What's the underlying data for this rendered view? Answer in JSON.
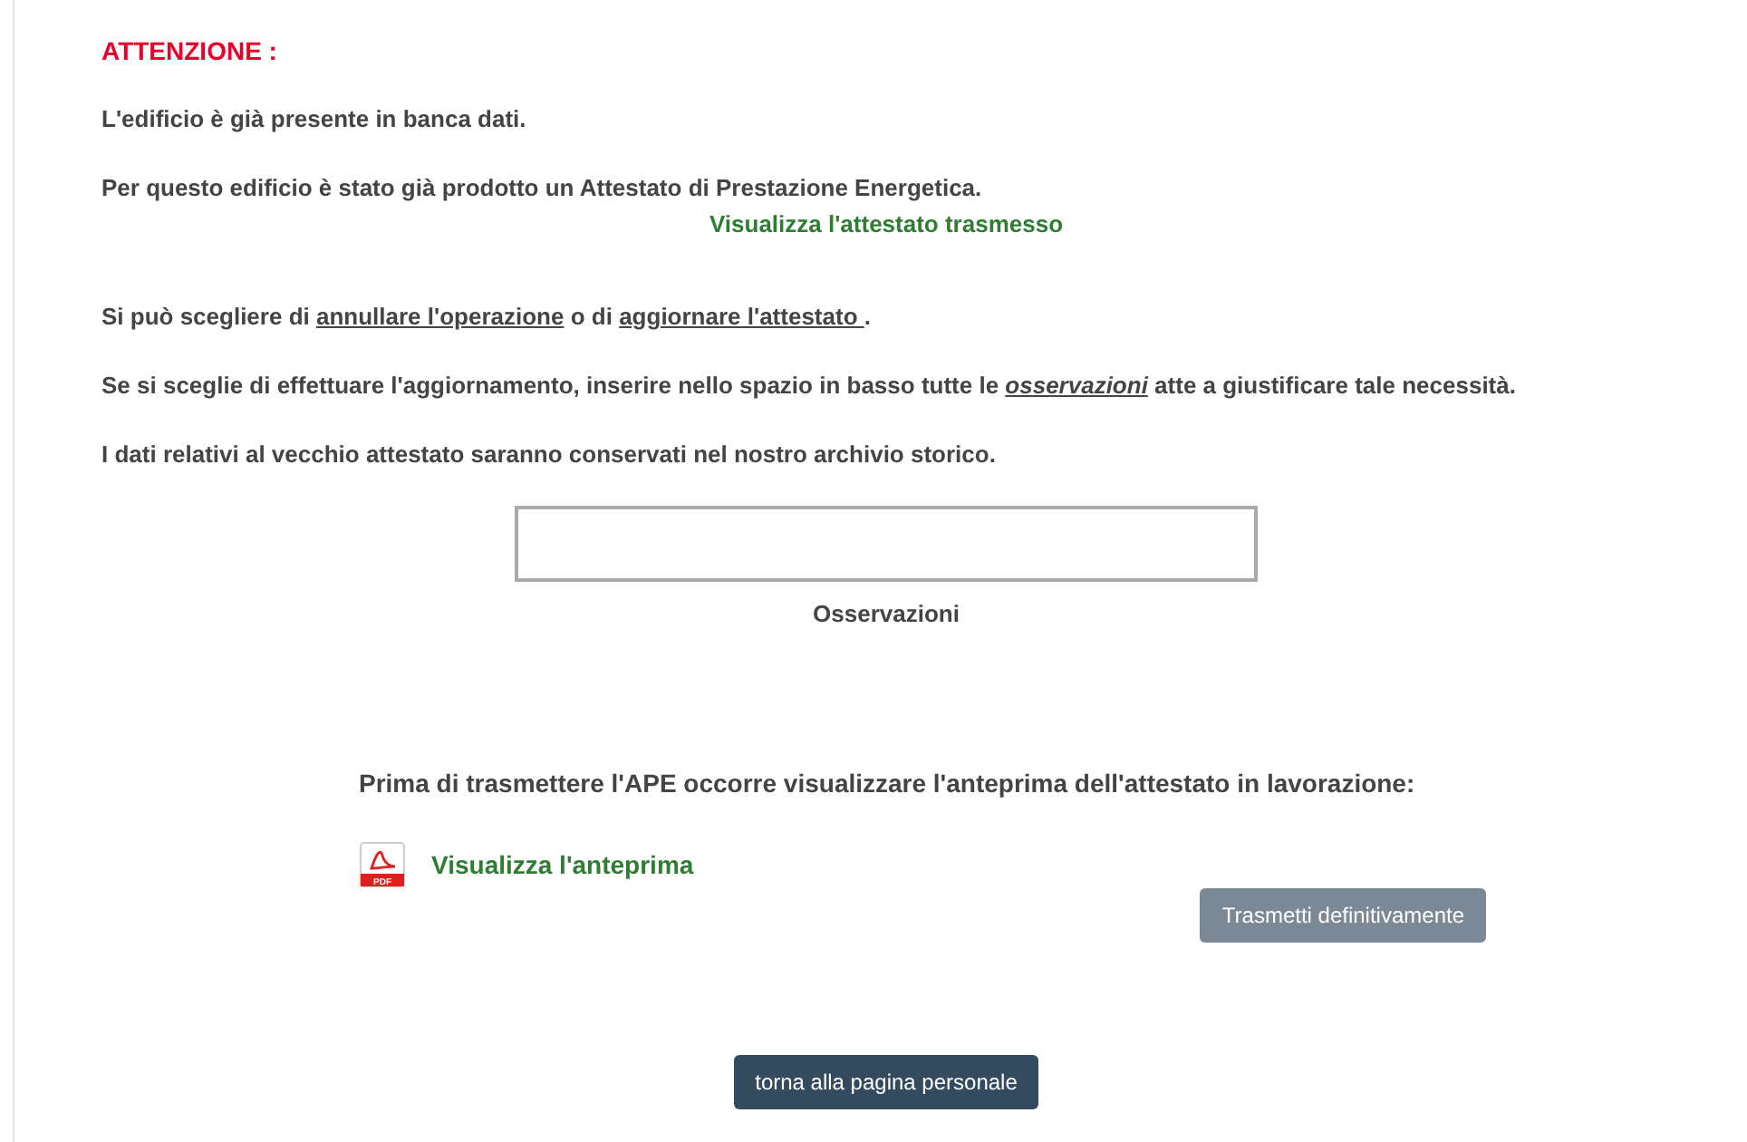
{
  "warning_title": "ATTENZIONE :",
  "paragraphs": [
    {
      "parts": [
        {
          "kind": "text",
          "text": "L'edificio è già presente in banca dati."
        }
      ]
    },
    {
      "parts": [
        {
          "kind": "text",
          "text": "Per questo edificio è stato già prodotto un Attestato di Prestazione Energetica."
        }
      ]
    }
  ],
  "view_link": "Visualizza l'attestato trasmesso",
  "options": [
    {
      "parts": [
        {
          "kind": "text",
          "text": "Si può scegliere di "
        },
        {
          "kind": "link",
          "text": "annullare l'operazione"
        },
        {
          "kind": "text",
          "text": " o di "
        },
        {
          "kind": "link",
          "text": "aggiornare l'attestato "
        },
        {
          "kind": "text",
          "text": "."
        }
      ]
    },
    {
      "parts": [
        {
          "kind": "text",
          "text": "Se si sceglie di effettuare l'aggiornamento, inserire nello spazio in basso tutte le "
        },
        {
          "kind": "italic-link",
          "text": "osservazioni"
        },
        {
          "kind": "text",
          "text": " atte a giustificare tale necessità."
        }
      ]
    },
    {
      "parts": [
        {
          "kind": "text",
          "text": "I dati relativi al vecchio attestato saranno conservati nel nostro archivio storico."
        }
      ]
    }
  ],
  "observations": {
    "label": "Osservazioni"
  },
  "preview_note": "Prima di trasmettere l'APE occorre visualizzare l'anteprima dell'attestato in lavorazione:",
  "preview_link": "Visualizza l'anteprima",
  "pdf_icon_text": "PDF",
  "transmit_button": {
    "label": "Trasmetti definitivamente",
    "disabled": true
  },
  "back_button": "torna alla pagina personale"
}
